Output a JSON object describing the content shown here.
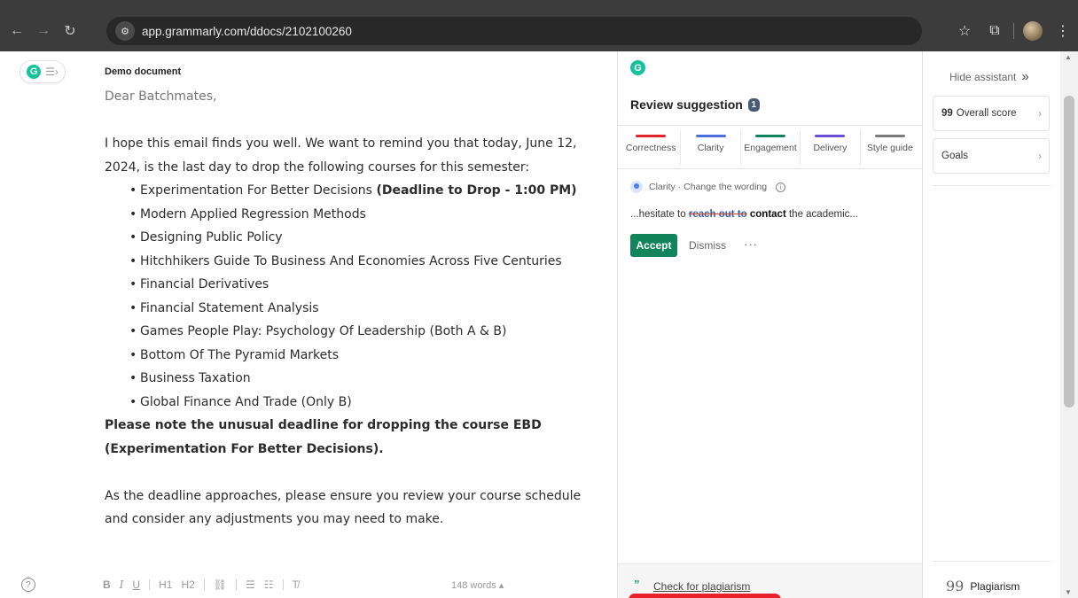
{
  "browser": {
    "url": "app.grammarly.com/ddocs/2102100260",
    "icons": [
      "back-icon",
      "forward-icon",
      "reload-icon",
      "site-settings-icon",
      "bookmark-star-icon",
      "extensions-icon",
      "profile-avatar",
      "kebab-menu-icon"
    ]
  },
  "editor": {
    "doc_title": "Demo document",
    "greeting": "Dear Batchmates,",
    "intro": "I hope this email finds you well. We want to remind you that today, June 12, 2024, is the last day to drop the following courses for this semester:",
    "courses": [
      {
        "name": "Experimentation For Better Decisions",
        "note": "(Deadline to Drop - 1:00 PM)"
      },
      {
        "name": "Modern Applied Regression Methods",
        "note": ""
      },
      {
        "name": "Designing Public Policy",
        "note": ""
      },
      {
        "name": "Hitchhikers Guide To Business And Economies Across Five Centuries",
        "note": ""
      },
      {
        "name": "Financial Derivatives",
        "note": ""
      },
      {
        "name": "Financial Statement Analysis",
        "note": ""
      },
      {
        "name": "Games People Play: Psychology Of Leadership (Both A & B)",
        "note": ""
      },
      {
        "name": "Bottom Of The Pyramid Markets",
        "note": ""
      },
      {
        "name": "Business Taxation",
        "note": ""
      },
      {
        "name": "Global Finance And Trade (Only B)",
        "note": ""
      }
    ],
    "bold_note": "Please note the unusual deadline for dropping the course EBD (Experimentation For Better Decisions).",
    "closing": "As the deadline approaches, please ensure you review your course schedule and consider any adjustments you may need to make.",
    "word_count": "148 words",
    "format_tools": [
      "B",
      "I",
      "U",
      "H1",
      "H2",
      "link",
      "ordered-list",
      "bullet-list",
      "clear-format"
    ]
  },
  "panel": {
    "title": "Review suggestion",
    "count": "1",
    "categories": [
      {
        "label": "Correctness",
        "color": "#e0262b"
      },
      {
        "label": "Clarity",
        "color": "#4a6fdc"
      },
      {
        "label": "Engagement",
        "color": "#12845c"
      },
      {
        "label": "Delivery",
        "color": "#6a4fd8"
      },
      {
        "label": "Style guide",
        "color": "#7a7a7a"
      }
    ],
    "suggestion": {
      "category": "Clarity",
      "action": "Change the wording",
      "prefix": "...hesitate to ",
      "removed": "reach out to",
      "inserted": "contact",
      "suffix": " the academic..."
    },
    "accept_label": "Accept",
    "dismiss_label": "Dismiss",
    "more_label": "···",
    "plagiarism_link": "Check for plagiarism"
  },
  "assistant": {
    "hide_label": "Hide assistant",
    "score_value": "99",
    "score_label": "Overall score",
    "goals_label": "Goals",
    "plagiarism_label": "Plagiarism"
  },
  "colors": {
    "grammarly_green": "#15c39a",
    "accept_green": "#12845c",
    "browser_chrome": "#3c3c3c"
  }
}
